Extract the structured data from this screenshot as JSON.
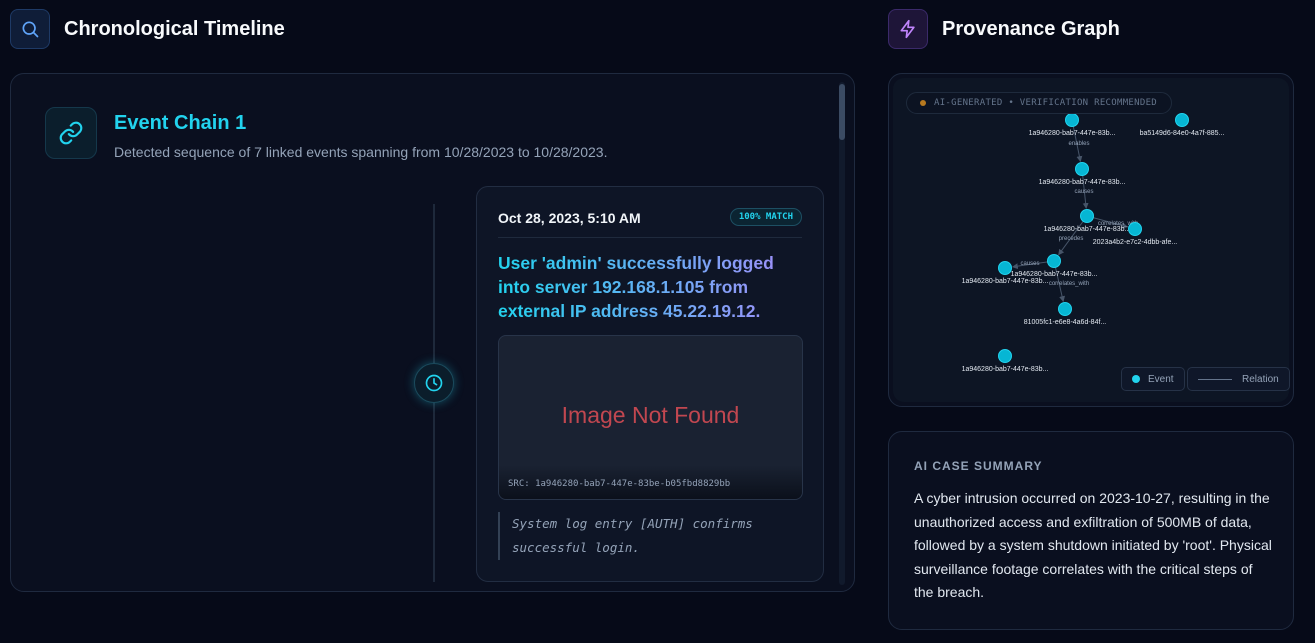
{
  "timeline": {
    "title": "Chronological Timeline",
    "chain": {
      "title": "Event Chain 1",
      "description": "Detected sequence of 7 linked events spanning from 10/28/2023 to 10/28/2023."
    },
    "event": {
      "date": "Oct 28, 2023, 5:10 AM",
      "match": "100% MATCH",
      "text": "User 'admin' successfully logged into server 192.168.1.105 from external IP address 45.22.19.12.",
      "image_error": "Image Not Found",
      "image_src": "SRC: 1a946280-bab7-447e-83be-b05fbd8829bb",
      "note": "System log entry [AUTH] confirms successful login."
    }
  },
  "graph": {
    "title": "Provenance Graph",
    "badge": "AI-GENERATED • VERIFICATION RECOMMENDED",
    "legend": {
      "event": "Event",
      "relation": "Relation"
    },
    "nodes": [
      {
        "label": "1a946280-bab7-447e-83b..."
      },
      {
        "label": "ba5149d6-84e0-4a7f-885..."
      },
      {
        "label": "1a946280-bab7-447e-83b..."
      },
      {
        "label": "1a946280-bab7-447e-83b..."
      },
      {
        "label": "2023a4b2-e7c2-4dbb-afe..."
      },
      {
        "label": "1a946280-bab7-447e-83b..."
      },
      {
        "label": "1a946280-bab7-447e-83b..."
      },
      {
        "label": "81005fc1-e6e8-4a6d-84f..."
      },
      {
        "label": "1a946280-bab7-447e-83b..."
      }
    ],
    "edges": [
      {
        "label": "enables"
      },
      {
        "label": "causes"
      },
      {
        "label": "correlates_with"
      },
      {
        "label": "precedes"
      },
      {
        "label": "causes"
      },
      {
        "label": "correlates_with"
      }
    ]
  },
  "summary": {
    "title": "AI CASE SUMMARY",
    "text": "A cyber intrusion occurred on 2023-10-27, resulting in the unauthorized access and exfiltration of 500MB of data, followed by a system shutdown initiated by 'root'. Physical surveillance footage correlates with the critical steps of the breach."
  },
  "colors": {
    "accent_cyan": "#22d3ee",
    "accent_purple": "#a78bfa",
    "error": "#c14750",
    "warning": "#b7791f"
  },
  "icons": {
    "timeline": "search-icon",
    "graph": "lightning-icon",
    "chain": "link-icon",
    "event": "clock-icon"
  }
}
